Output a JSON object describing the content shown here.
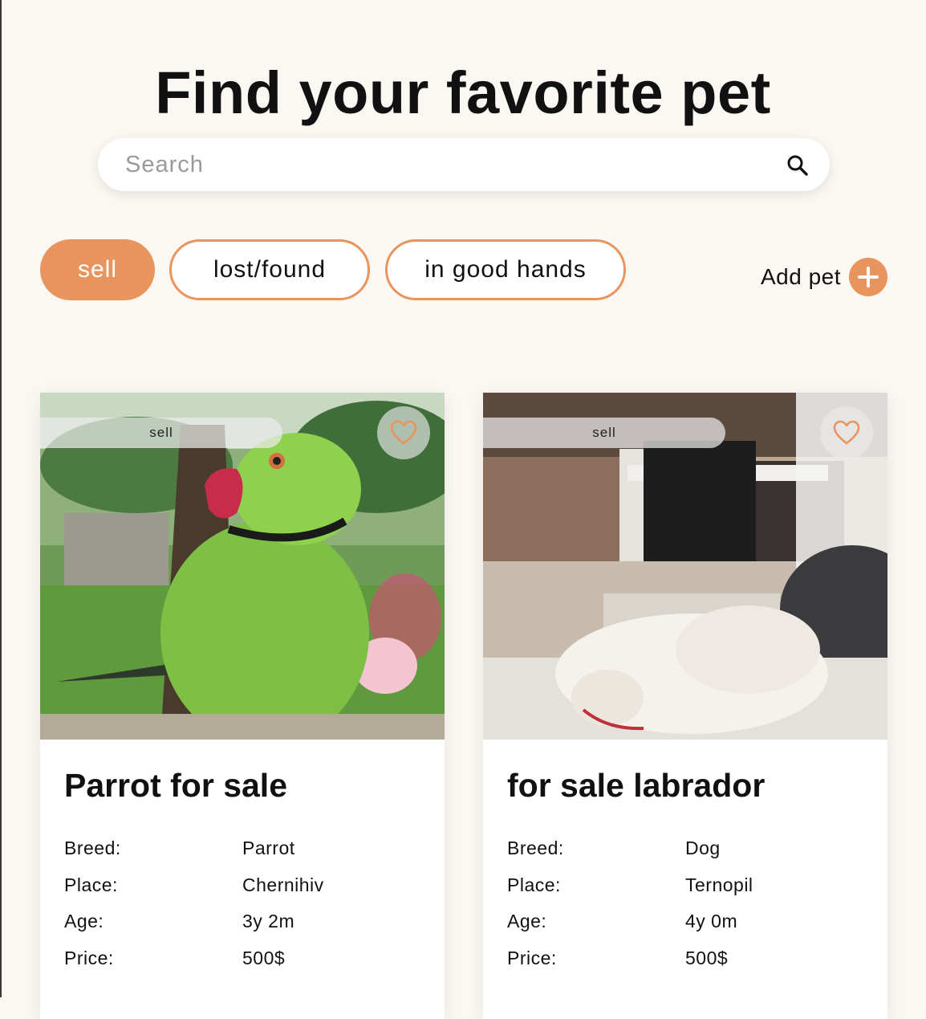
{
  "page": {
    "title": "Find your favorite pet"
  },
  "search": {
    "placeholder": "Search",
    "value": ""
  },
  "filters": [
    {
      "label": "sell",
      "active": true
    },
    {
      "label": "lost/found",
      "active": false
    },
    {
      "label": "in good hands",
      "active": false
    }
  ],
  "add_pet": {
    "label": "Add pet",
    "icon": "plus-icon"
  },
  "colors": {
    "accent": "#e8955d",
    "background": "#fbf7f3"
  },
  "cards": [
    {
      "category": "sell",
      "title": "Parrot for sale",
      "image": "green parrot photo",
      "details": [
        {
          "label": "Breed:",
          "value": "Parrot"
        },
        {
          "label": "Place:",
          "value": "Chernihiv"
        },
        {
          "label": "Age:",
          "value": "3y 2m"
        },
        {
          "label": "Price:",
          "value": "500$"
        }
      ]
    },
    {
      "category": "sell",
      "title": "for sale labrador",
      "image": "white labrador lying on floor photo",
      "details": [
        {
          "label": "Breed:",
          "value": "Dog"
        },
        {
          "label": "Place:",
          "value": "Ternopil"
        },
        {
          "label": "Age:",
          "value": "4y 0m"
        },
        {
          "label": "Price:",
          "value": "500$"
        }
      ]
    }
  ]
}
